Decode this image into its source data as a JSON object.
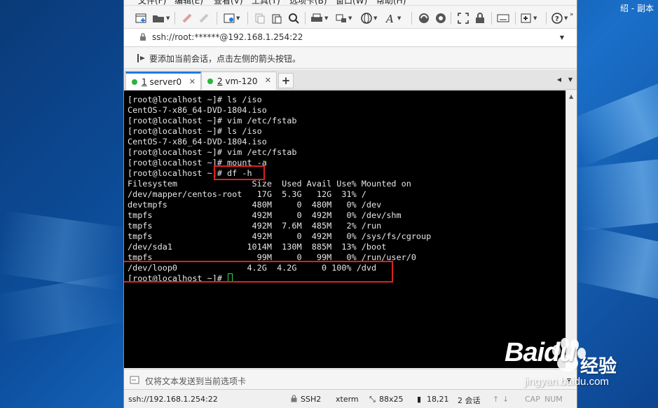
{
  "desktop": {
    "title_text": "绍 - 副本"
  },
  "menu": {
    "items": [
      "文件(F)",
      "编辑(E)",
      "查看(V)",
      "工具(T)",
      "选项卡(B)",
      "窗口(W)",
      "帮助(H)"
    ]
  },
  "address": {
    "value": "ssh://root:******@192.168.1.254:22"
  },
  "hint": {
    "text": "要添加当前会话，点击左侧的箭头按钮。"
  },
  "tabs": [
    {
      "number": "1",
      "label": "server0",
      "status_color": "#2bb33a"
    },
    {
      "number": "2",
      "label": "vm-120",
      "status_color": "#2bb33a"
    }
  ],
  "tab_add_label": "+",
  "terminal": {
    "lines": [
      "[root@localhost ~]# ls /iso",
      "CentOS-7-x86_64-DVD-1804.iso",
      "[root@localhost ~]# vim /etc/fstab",
      "[root@localhost ~]# ls /iso",
      "CentOS-7-x86_64-DVD-1804.iso",
      "[root@localhost ~]# vim /etc/fstab",
      "[root@localhost ~]# mount -a",
      "[root@localhost ~]# df -h",
      "Filesystem               Size  Used Avail Use% Mounted on",
      "/dev/mapper/centos-root   17G  5.3G   12G  31% /",
      "devtmpfs                 480M     0  480M   0% /dev",
      "tmpfs                    492M     0  492M   0% /dev/shm",
      "tmpfs                    492M  7.6M  485M   2% /run",
      "tmpfs                    492M     0  492M   0% /sys/fs/cgroup",
      "/dev/sda1               1014M  130M  885M  13% /boot",
      "tmpfs                     99M     0   99M   0% /run/user/0",
      "/dev/loop0              4.2G  4.2G     0 100% /dvd"
    ],
    "prompt": "[root@localhost ~]# ",
    "cursor_color": "#39d353",
    "highlight_color": "#d9231c"
  },
  "sendbar": {
    "placeholder": "仅将文本发送到当前选项卡"
  },
  "status": {
    "connection": "ssh://192.168.1.254:22",
    "protocol": "SSH2",
    "terminal_type": "xterm",
    "size": "88x25",
    "position": "18,21",
    "sessions": "2 会话",
    "cap": "CAP",
    "num": "NUM"
  },
  "watermark": {
    "brand": "Baidu",
    "brand_cn": "经验",
    "url": "jingyan.baidu.com"
  }
}
